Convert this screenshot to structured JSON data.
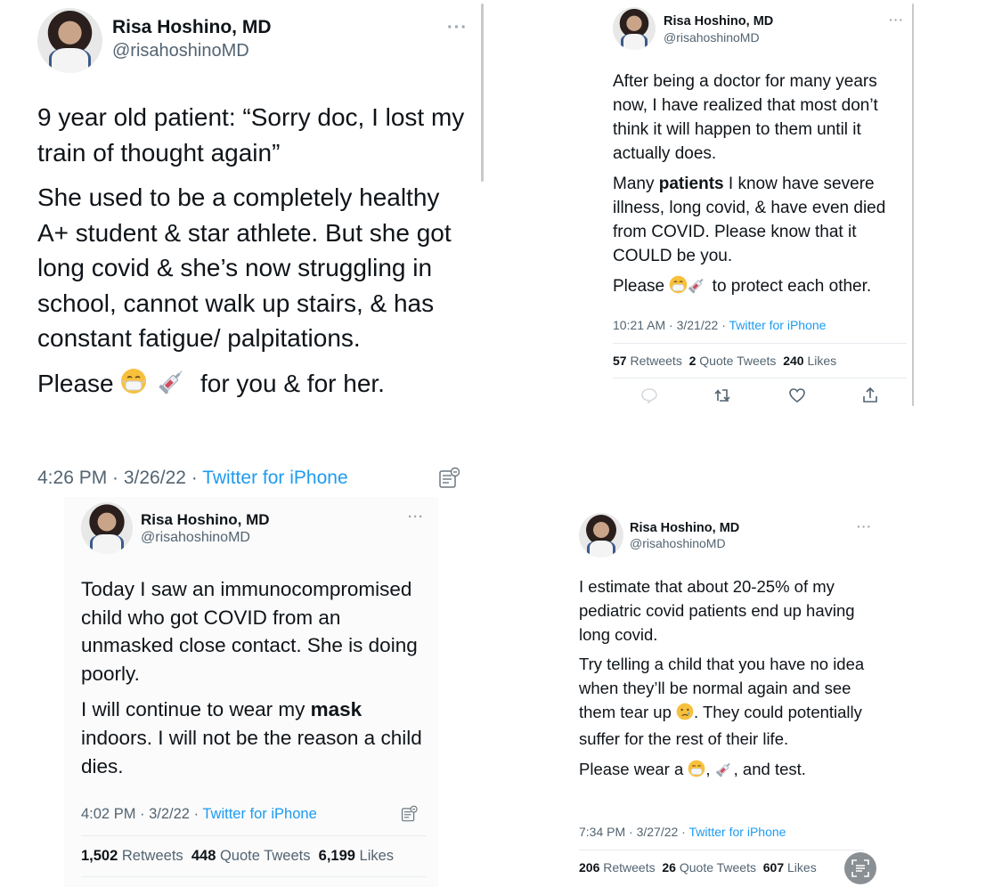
{
  "author": {
    "name": "Risa Hoshino, MD",
    "handle": "@risahoshinoMD"
  },
  "more_label": "···",
  "tweet1": {
    "line1": "9 year old patient: “Sorry doc, I lost my train of thought again”",
    "line2": "She used to be a completely healthy A+ student & star athlete. But she got long covid & she’s now struggling in school, cannot walk up stairs, & has constant fatigue/ palpitations.",
    "line3_start": "Please",
    "line3_end": "for you & for her.",
    "time": "4:26 PM · 3/26/22 · ",
    "source": "Twitter for iPhone"
  },
  "tweet2": {
    "para1": "After being a doctor for many years now, I have realized that most don’t think it will happen to them until it actually does.",
    "para2_a": "Many ",
    "para2_bold": "patients",
    "para2_b": " I know have severe illness, long covid, & have even died from COVID. Please know that it COULD be you.",
    "para3_start": "Please",
    "para3_end": "to protect each other.",
    "time": "10:21 AM · 3/21/22 · ",
    "source": "Twitter for iPhone",
    "retweets": "57",
    "retweets_label": " Retweets",
    "quotes": "2",
    "quotes_label": " Quote Tweets",
    "likes": "240",
    "likes_label": " Likes"
  },
  "tweet3": {
    "para1": "Today I saw an immunocompromised child who got COVID from an unmasked close contact. She is doing poorly.",
    "para2_a": "I will continue to wear my ",
    "para2_bold": "mask",
    "para2_b": " indoors. I will not be the reason a child dies.",
    "time": "4:02 PM · 3/2/22 · ",
    "source": "Twitter for iPhone",
    "retweets": "1,502",
    "retweets_label": " Retweets",
    "quotes": "448",
    "quotes_label": " Quote Tweets",
    "likes": "6,199",
    "likes_label": " Likes"
  },
  "tweet4": {
    "para1": "I estimate that about 20-25% of my pediatric covid patients end up having long covid.",
    "para2_a": "Try telling a child that you have no idea when they’ll be normal again and see them tear up",
    "para2_b": ". They could potentially suffer for the rest of their life.",
    "para3_a": "Please wear a",
    "para3_comma1": ",",
    "para3_b": ", and test.",
    "time": "7:34 PM · 3/27/22 · ",
    "source": "Twitter for iPhone",
    "retweets": "206",
    "retweets_label": " Retweets",
    "quotes": "26",
    "quotes_label": " Quote Tweets",
    "likes": "607",
    "likes_label": " Likes"
  },
  "icons": [
    "mask-face-emoji-icon",
    "syringe-emoji-icon",
    "crying-face-emoji-icon",
    "reply-icon",
    "retweet-icon",
    "like-icon",
    "share-icon",
    "document-icon",
    "text-scan-icon"
  ],
  "colors": {
    "link": "#1d9bf0",
    "secondary_text": "#536471",
    "primary_text": "#0f1419"
  }
}
